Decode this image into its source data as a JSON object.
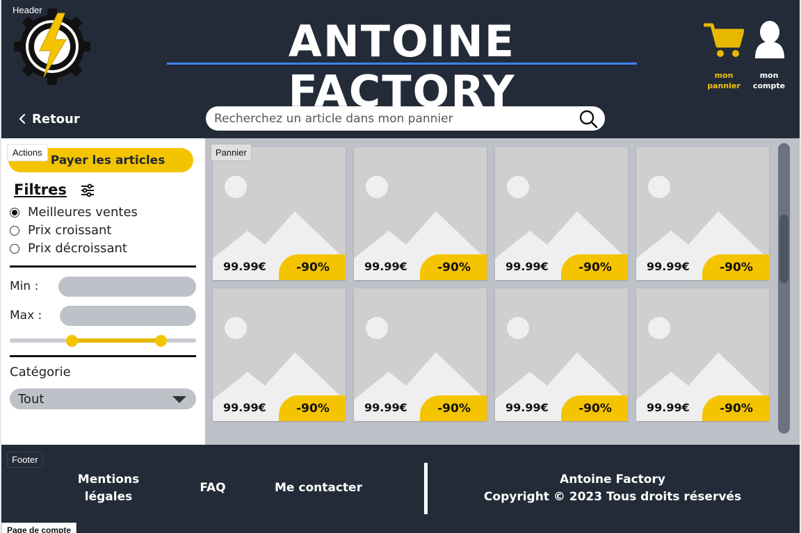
{
  "header": {
    "tag": "Header",
    "brand": "ANTOINE FACTORY",
    "cart_label_1": "mon",
    "cart_label_2": "pannier",
    "account_label_1": "mon",
    "account_label_2": "compte",
    "back_label": "Retour",
    "search_placeholder": "Recherchez un article dans mon pannier",
    "colors": {
      "background": "#232b38",
      "accent": "#f5c400",
      "underline": "#3b82f6"
    }
  },
  "sidebar": {
    "tag": "Actions",
    "pay_button": "Payer les articles",
    "filters_title": "Filtres",
    "sort_options": [
      {
        "label": "Meilleures ventes",
        "checked": true
      },
      {
        "label": "Prix croissant",
        "checked": false
      },
      {
        "label": "Prix décroissant",
        "checked": false
      }
    ],
    "min_label": "Min :",
    "max_label": "Max :",
    "price_slider": {
      "low": 0.34,
      "high": 0.81
    },
    "category_label": "Catégorie",
    "category_value": "Tout"
  },
  "products": {
    "tag": "Pannier",
    "items": [
      {
        "price": "99.99€",
        "discount": "-90%"
      },
      {
        "price": "99.99€",
        "discount": "-90%"
      },
      {
        "price": "99.99€",
        "discount": "-90%"
      },
      {
        "price": "99.99€",
        "discount": "-90%"
      },
      {
        "price": "99.99€",
        "discount": "-90%"
      },
      {
        "price": "99.99€",
        "discount": "-90%"
      },
      {
        "price": "99.99€",
        "discount": "-90%"
      },
      {
        "price": "99.99€",
        "discount": "-90%"
      }
    ]
  },
  "footer": {
    "tag": "Footer",
    "mentions_1": "Mentions",
    "mentions_2": "légales",
    "faq": "FAQ",
    "contact": "Me contacter",
    "company": "Antoine Factory",
    "copyright": "Copyright © 2023 Tous droits réservés"
  },
  "page_tag": "Page de compte"
}
